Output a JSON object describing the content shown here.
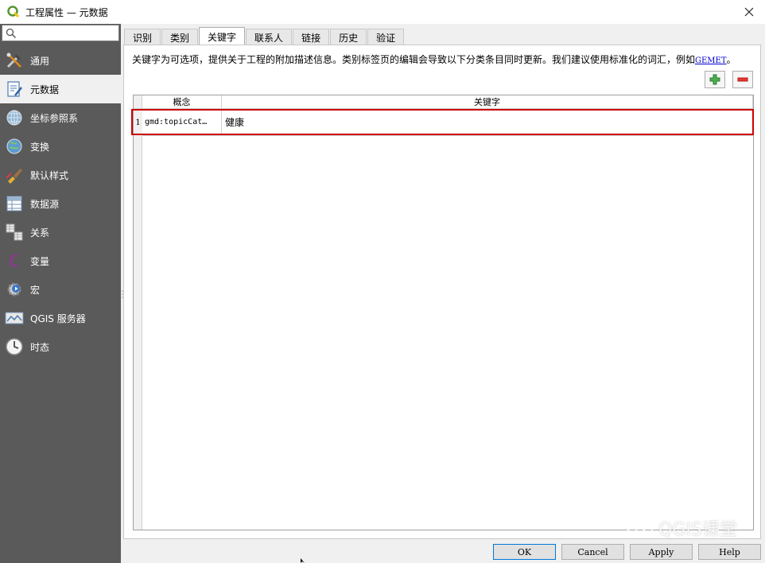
{
  "window": {
    "title": "工程属性 — 元数据"
  },
  "sidebar": {
    "search_placeholder": "",
    "items": [
      {
        "label": "通用",
        "icon": "wrench-hammer-icon"
      },
      {
        "label": "元数据",
        "icon": "metadata-edit-icon"
      },
      {
        "label": "坐标参照系",
        "icon": "globe-grid-icon"
      },
      {
        "label": "变换",
        "icon": "globe-transform-icon"
      },
      {
        "label": "默认样式",
        "icon": "paintbrush-icon"
      },
      {
        "label": "数据源",
        "icon": "table-icon"
      },
      {
        "label": "关系",
        "icon": "relations-icon"
      },
      {
        "label": "变量",
        "icon": "epsilon-icon"
      },
      {
        "label": "宏",
        "icon": "gear-play-icon"
      },
      {
        "label": "QGIS 服务器",
        "icon": "server-map-icon"
      },
      {
        "label": "时态",
        "icon": "clock-icon"
      }
    ],
    "active_index": 1
  },
  "tabs": [
    {
      "label": "识别"
    },
    {
      "label": "类别"
    },
    {
      "label": "关键字"
    },
    {
      "label": "联系人"
    },
    {
      "label": "链接"
    },
    {
      "label": "历史"
    },
    {
      "label": "验证"
    }
  ],
  "active_tab": 2,
  "keywords_panel": {
    "description": "关键字为可选项，提供关于工程的附加描述信息。类别标签页的编辑会导致以下分类条目同时更新。我们建议使用标准化的词汇，例如",
    "link_text": "GEMET",
    "description_end": "。",
    "add_button_icon": "plus-icon",
    "remove_button_icon": "minus-icon",
    "table": {
      "columns": [
        "概念",
        "关键字"
      ],
      "rows": [
        {
          "num": "1",
          "concept": "gmd:topicCat…",
          "keyword": "健康"
        }
      ]
    }
  },
  "buttons": {
    "ok": "OK",
    "cancel": "Cancel",
    "apply": "Apply",
    "help": "Help"
  },
  "watermark": "QGIS课堂",
  "colors": {
    "sidebar_bg": "#5a5a5a",
    "highlight_border": "#cc0000",
    "link": "#0000cc",
    "add_green": "#2e8b2e",
    "remove_red": "#cc2222"
  }
}
